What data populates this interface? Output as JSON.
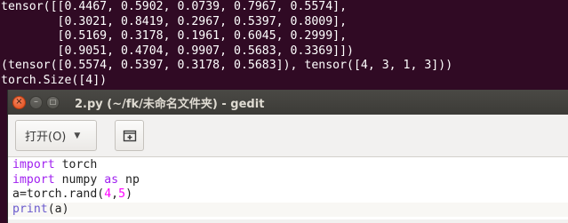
{
  "terminal": {
    "lines": [
      "tensor([[0.4467, 0.5902, 0.0739, 0.7967, 0.5574],",
      "        [0.3021, 0.8419, 0.2967, 0.5397, 0.8009],",
      "        [0.5169, 0.3178, 0.1961, 0.6045, 0.2999],",
      "        [0.9051, 0.4704, 0.9907, 0.5683, 0.3369]])",
      "(tensor([0.5574, 0.5397, 0.3178, 0.5683]), tensor([4, 3, 1, 3]))",
      "torch.Size([4])"
    ]
  },
  "window": {
    "title": "2.py (~/fk/未命名文件夹) - gedit",
    "close_glyph": "×",
    "min_glyph": "–",
    "max_glyph": "□"
  },
  "toolbar": {
    "open_label": "打开(O)",
    "open_arrow": "▼"
  },
  "editor": {
    "line1": {
      "kw": "import",
      "rest": " torch"
    },
    "line2": {
      "kw1": "import",
      "mid": " numpy ",
      "kw2": "as",
      "rest": " np"
    },
    "line3": {
      "pre": "a=torch.rand(",
      "n1": "4",
      "comma": ",",
      "n2": "5",
      "post": ")"
    },
    "line4": {
      "fn": "print",
      "rest": "(a)"
    }
  },
  "colors": {
    "terminal_bg": "#300a24",
    "keyword": "#a020f0",
    "number": "#ff00ff",
    "close_button": "#df4a16"
  }
}
